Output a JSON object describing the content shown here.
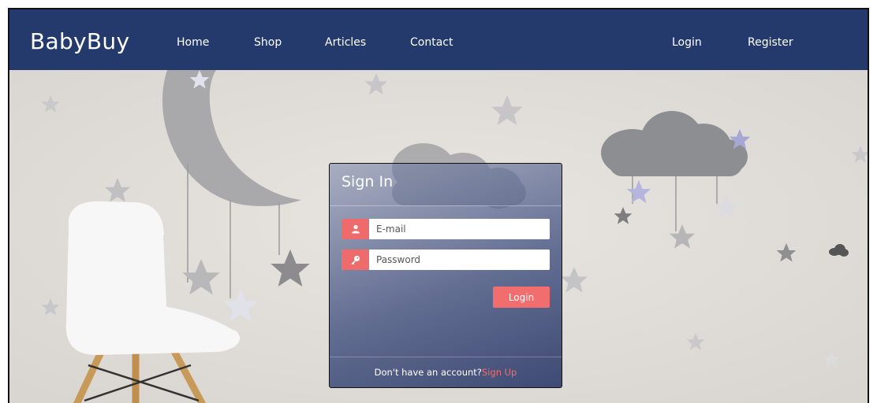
{
  "nav": {
    "brand": "BabyBuy",
    "links": [
      {
        "label": "Home"
      },
      {
        "label": "Shop"
      },
      {
        "label": "Articles"
      },
      {
        "label": "Contact"
      }
    ],
    "login_label": "Login",
    "register_label": "Register"
  },
  "signin": {
    "title": "Sign In",
    "email_placeholder": "E-mail",
    "email_value": "",
    "password_placeholder": "Password",
    "password_value": "",
    "login_button": "Login",
    "footer_text": "Don't have an account?",
    "signup_link": "Sign Up"
  },
  "icons": {
    "email_field": "user-icon",
    "password_field": "key-icon"
  },
  "colors": {
    "navbar": "#253a6c",
    "accent": "#f26d6d",
    "wall": "#e4e1dc"
  }
}
